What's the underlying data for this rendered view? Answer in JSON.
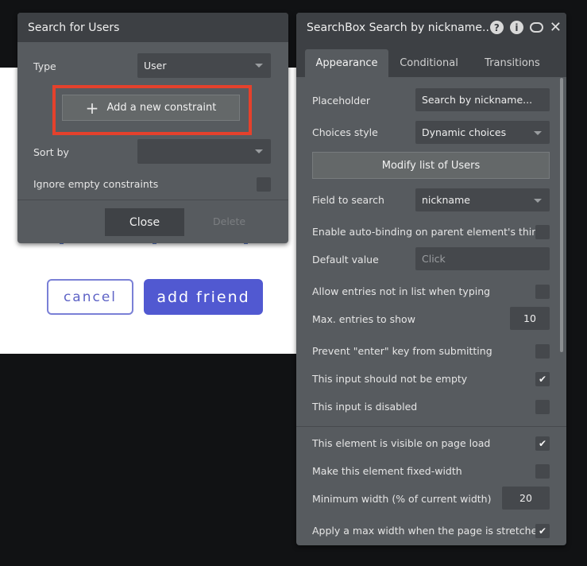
{
  "canvas": {
    "cancel_label": "cancel",
    "add_friend_label": "add friend"
  },
  "search_panel": {
    "title": "Search for Users",
    "type_label": "Type",
    "type_value": "User",
    "add_constraint_label": "Add a new constraint",
    "sort_by_label": "Sort by",
    "sort_by_value": "",
    "ignore_empty_label": "Ignore empty constraints",
    "close_label": "Close",
    "delete_label": "Delete"
  },
  "editor_panel": {
    "title": "SearchBox Search by nickname..",
    "tabs": [
      {
        "label": "Appearance",
        "active": true
      },
      {
        "label": "Conditional",
        "active": false
      },
      {
        "label": "Transitions",
        "active": false
      }
    ],
    "placeholder_label": "Placeholder",
    "placeholder_value": "Search by nickname...",
    "choices_style_label": "Choices style",
    "choices_style_value": "Dynamic choices",
    "modify_list_label": "Modify list of Users",
    "field_to_search_label": "Field to search",
    "field_to_search_value": "nickname",
    "auto_binding_label": "Enable auto-binding on parent element's thing",
    "default_value_label": "Default value",
    "default_value_placeholder": "Click",
    "allow_entries_label": "Allow entries not in list when typing",
    "max_entries_label": "Max. entries to show",
    "max_entries_value": "10",
    "prevent_enter_label": "Prevent \"enter\" key from submitting",
    "not_empty_label": "This input should not be empty",
    "disabled_label": "This input is disabled",
    "visible_label": "This element is visible on page load",
    "fixed_width_label": "Make this element fixed-width",
    "min_width_label": "Minimum width (% of current width)",
    "min_width_value": "20",
    "max_width_label": "Apply a max width when the page is stretched"
  },
  "icons": {
    "help": "help-icon",
    "info": "info-icon",
    "comment": "comment-icon",
    "close": "close-icon",
    "check": "checkmark-icon",
    "plus": "plus-icon",
    "caret": "chevron-down-icon"
  }
}
